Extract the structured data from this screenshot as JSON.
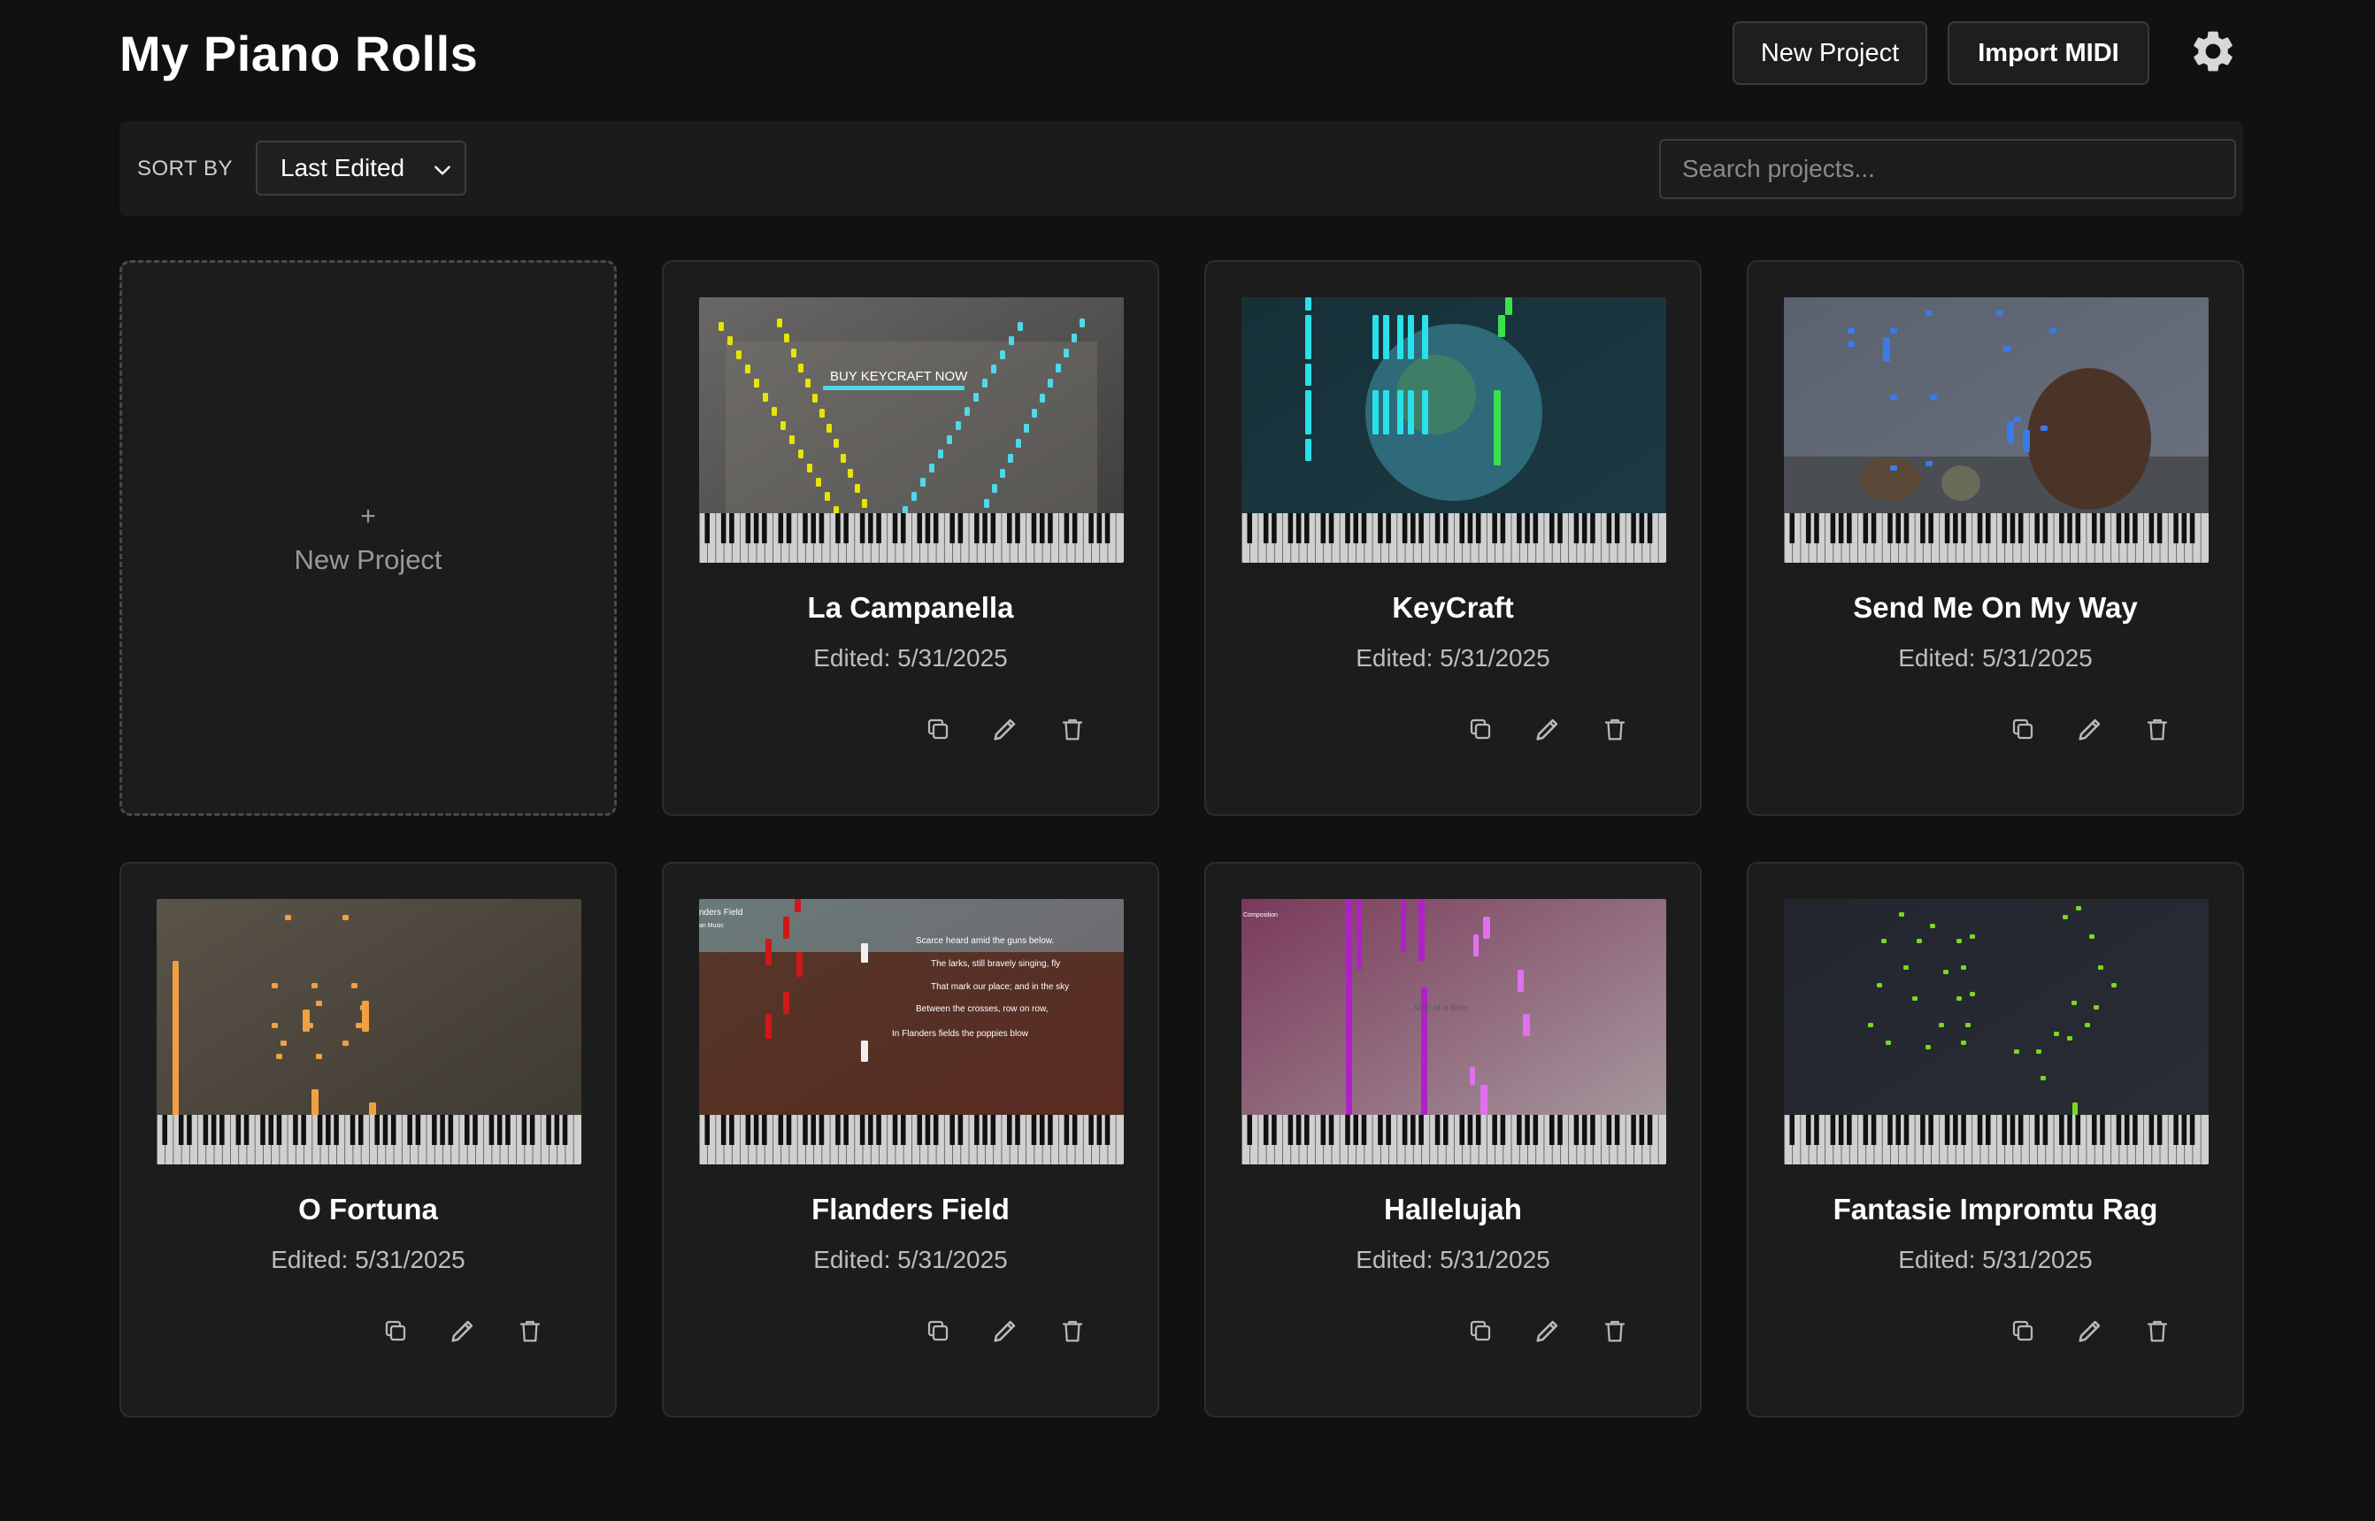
{
  "header": {
    "title": "My Piano Rolls",
    "new_project_label": "New Project",
    "import_label": "Import MIDI",
    "settings_icon": "gear-icon"
  },
  "toolbar": {
    "sort_label": "SORT BY",
    "sort_value": "Last Edited",
    "search_placeholder": "Search projects..."
  },
  "new_card": {
    "plus": "+",
    "label": "New Project"
  },
  "projects": [
    {
      "title": "La Campanella",
      "date": "Edited: 5/31/2025",
      "accent": "#e6e600",
      "accent2": "#4fd8e8",
      "overlay_text": "BUY KEYCRAFT NOW"
    },
    {
      "title": "KeyCraft",
      "date": "Edited: 5/31/2025",
      "accent": "#2be0e8",
      "accent2": "#3be04a"
    },
    {
      "title": "Send Me On My Way",
      "date": "Edited: 5/31/2025",
      "accent": "#3b7ae8"
    },
    {
      "title": "O Fortuna",
      "date": "Edited: 5/31/2025",
      "accent": "#f0a040"
    },
    {
      "title": "Flanders Field",
      "date": "Edited: 5/31/2025",
      "accent": "#d01818",
      "lyrics": [
        "Scarce heard amid the guns below.",
        "The larks, still bravely singing, fly",
        "That mark our place; and in the sky",
        "Between the crosses, row on row,",
        "In Flanders fields the poppies blow"
      ],
      "label_tl": "nders Field",
      "label_tl2": "an Music"
    },
    {
      "title": "Hallelujah",
      "date": "Edited: 5/31/2025",
      "accent": "#b020c8",
      "accent2": "#e070f0",
      "overlay_text": "step at a time.",
      "label_tl": "Composition"
    },
    {
      "title": "Fantasie Impromtu Rag",
      "date": "Edited: 5/31/2025",
      "accent": "#7ad820"
    }
  ]
}
